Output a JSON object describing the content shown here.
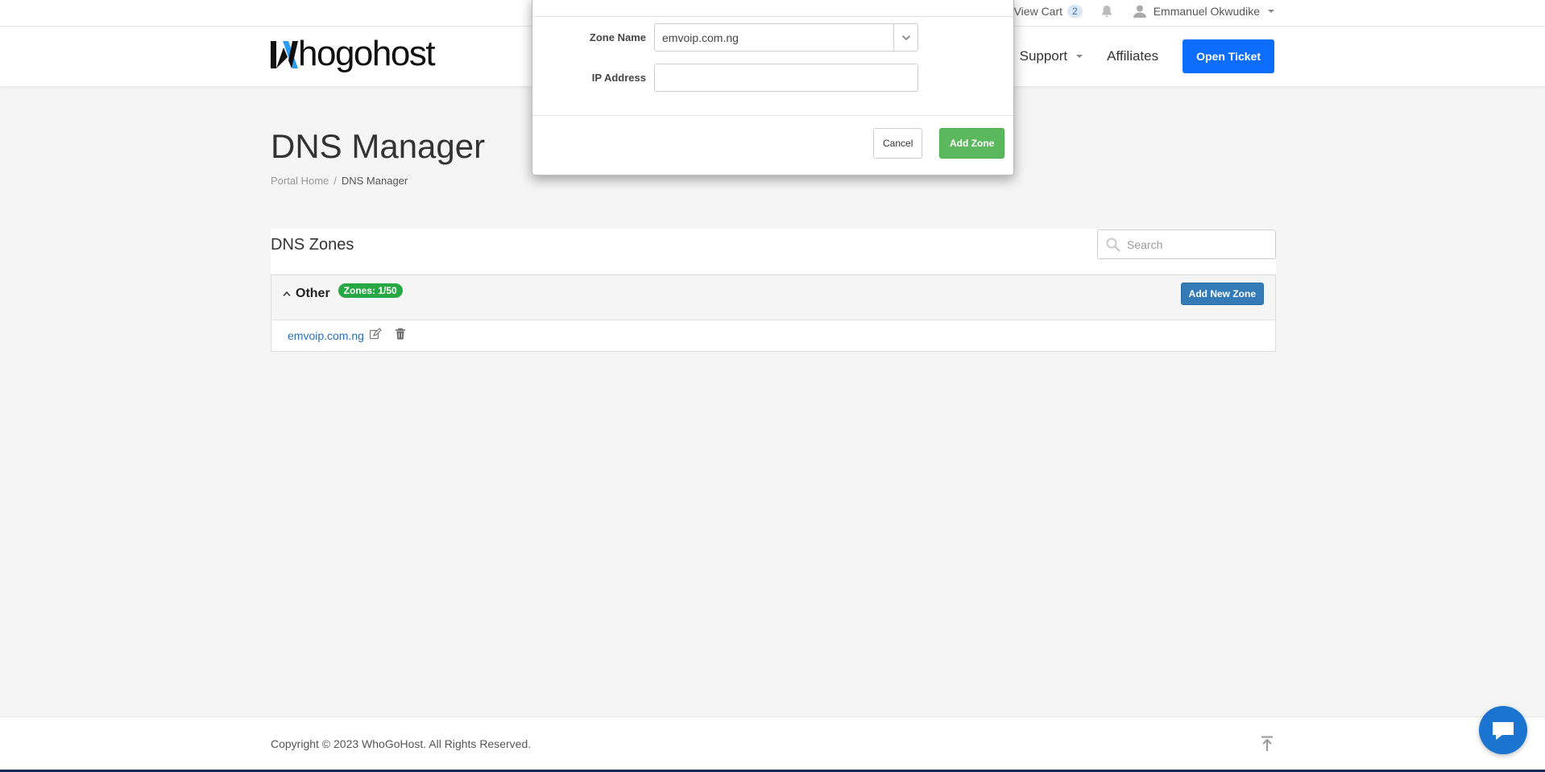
{
  "topbar": {
    "cart_label": "View Cart",
    "cart_count": "2",
    "user_name": "Emmanuel Okwudike"
  },
  "header": {
    "logo_text": "hogohost",
    "nav": {
      "support_label": "Support",
      "affiliates_label": "Affiliates",
      "open_ticket_label": "Open Ticket"
    }
  },
  "page": {
    "title": "DNS Manager",
    "breadcrumb": {
      "home": "Portal Home",
      "separator": "/",
      "current": "DNS Manager"
    }
  },
  "zones": {
    "title": "DNS Zones",
    "search_placeholder": "Search",
    "group_name": "Other",
    "zones_badge": "Zones: 1/50",
    "add_new_label": "Add New Zone",
    "items": [
      {
        "name": "emvoip.com.ng"
      }
    ]
  },
  "modal": {
    "zone_name_label": "Zone Name",
    "zone_name_value": "emvoip.com.ng",
    "ip_address_label": "IP Address",
    "ip_address_value": "",
    "cancel_label": "Cancel",
    "add_zone_label": "Add Zone"
  },
  "footer": {
    "copyright": "Copyright © 2023 WhoGoHost. All Rights Reserved."
  },
  "colors": {
    "primary": "#0d6efd",
    "success": "#5cb85c",
    "badge_green": "#28a745",
    "link_blue": "#2a6fb6",
    "add_new_blue": "#337ab7",
    "chat_blue": "#1b75d0"
  }
}
